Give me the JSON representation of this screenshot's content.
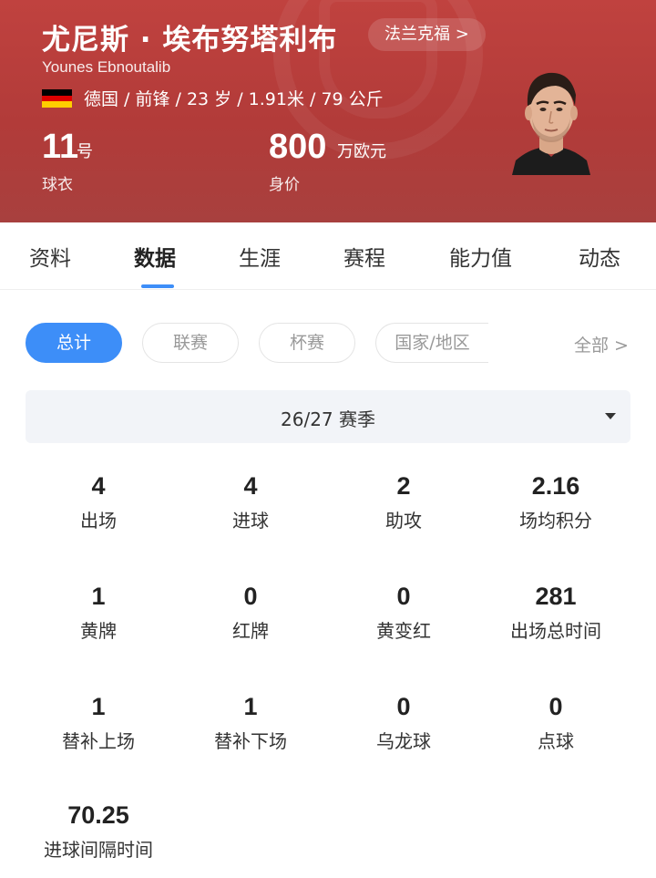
{
  "header": {
    "player_name": "尤尼斯 · 埃布努塔利布",
    "team_link": "法兰克福 >",
    "player_name_en": "Younes Ebnoutalib",
    "info": "德国 / 前锋 / 23 岁 / 1.91米 / 79 公斤",
    "shirt": {
      "number": "11",
      "unit": "号",
      "label": "球衣"
    },
    "value": {
      "number": "800",
      "unit": "万欧元",
      "label": "身价"
    },
    "flag_colors": [
      "#000000",
      "#DD0000",
      "#FFCE00"
    ],
    "accent_color": "#B83F3C"
  },
  "tabs": [
    {
      "label": "资料",
      "active": false
    },
    {
      "label": "数据",
      "active": true
    },
    {
      "label": "生涯",
      "active": false
    },
    {
      "label": "赛程",
      "active": false
    },
    {
      "label": "能力值",
      "active": false
    },
    {
      "label": "动态",
      "active": false
    }
  ],
  "filters": {
    "chips": [
      {
        "label": "总计",
        "active": true
      },
      {
        "label": "联赛",
        "active": false
      },
      {
        "label": "杯赛",
        "active": false
      },
      {
        "label": "国家/地区",
        "active": false
      }
    ],
    "more_label": "全部 >",
    "active_color": "#3D8EF8"
  },
  "season": {
    "label": "26/27 赛季",
    "icon": "dropdown-caret-icon"
  },
  "stats": [
    {
      "value": "4",
      "label": "出场"
    },
    {
      "value": "4",
      "label": "进球"
    },
    {
      "value": "2",
      "label": "助攻"
    },
    {
      "value": "2.16",
      "label": "场均积分"
    },
    {
      "value": "1",
      "label": "黄牌"
    },
    {
      "value": "0",
      "label": "红牌"
    },
    {
      "value": "0",
      "label": "黄变红"
    },
    {
      "value": "281",
      "label": "出场总时间"
    },
    {
      "value": "1",
      "label": "替补上场"
    },
    {
      "value": "1",
      "label": "替补下场"
    },
    {
      "value": "0",
      "label": "乌龙球"
    },
    {
      "value": "0",
      "label": "点球"
    },
    {
      "value": "70.25",
      "label": "进球间隔时间"
    }
  ]
}
